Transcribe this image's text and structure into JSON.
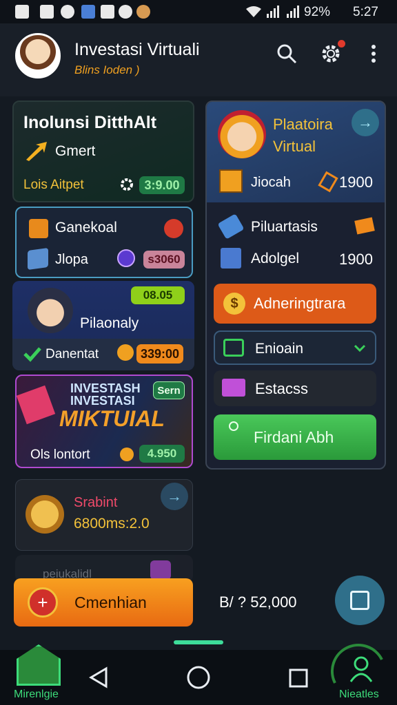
{
  "status": {
    "battery": "92%",
    "time": "5:27"
  },
  "header": {
    "title": "Investasi Virtuali",
    "subtitle": "Blins Ioden )"
  },
  "card1": {
    "title": "Inolunsi DitthAlt",
    "sub": "Gmert",
    "label": "Lois Aitpet",
    "value": "3:9.00"
  },
  "card2": {
    "label": "Ganekoal",
    "sub": "Jlopa",
    "value": "s3060"
  },
  "card3": {
    "badge": "08.05",
    "title": "Pilaonaly",
    "label": "Danentat",
    "value": "339:00"
  },
  "card4": {
    "line1": "INVESTASH",
    "line2": "INVESTASI",
    "line3": "MIKTUIAL",
    "badge": "Sern",
    "label": "Ols lontort",
    "value": "4.950"
  },
  "card5": {
    "title": "Srabint",
    "value": "6800ms:2.0"
  },
  "card6": {
    "text": "peiukalidl"
  },
  "right_card": {
    "title_line1": "Plaatoira",
    "title_line2": "Virtual",
    "row1_label": "Jiocah",
    "row1_value": "1900",
    "row2_label": "Piluartasis",
    "row3_label": "Adolgel",
    "row3_value": "1900"
  },
  "buttons": {
    "orange": "Adneringtrara",
    "select": "Enioain",
    "mail": "Estacss",
    "green": "Firdani Abh"
  },
  "bottom": {
    "cta": "Cmenhian",
    "amount": "B/ ? 52,000"
  },
  "nav": {
    "left_label": "Mirenlgie",
    "right_label": "Nieatles"
  },
  "colors": {
    "orange": "#f08a1c",
    "green": "#36b24a",
    "teal": "#2f6f8a",
    "accent_green": "#3ddc7a"
  }
}
